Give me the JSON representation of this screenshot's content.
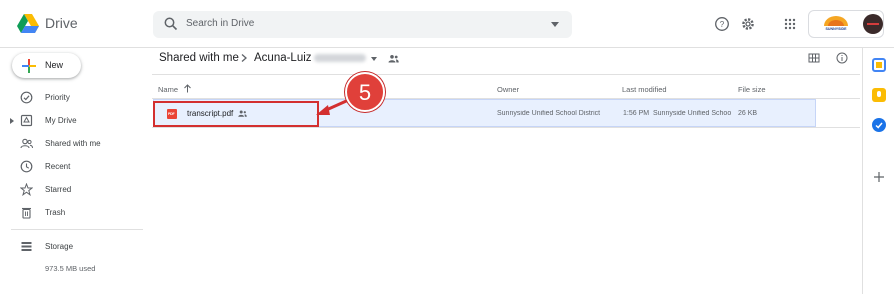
{
  "app": {
    "name": "Drive"
  },
  "search": {
    "placeholder": "Search in Drive"
  },
  "header": {
    "icons": [
      "help-icon",
      "settings-icon",
      "apps-grid-icon"
    ],
    "account": {
      "org_logo": "SUNNYSIDE",
      "avatar": "avatar"
    }
  },
  "sidebar": {
    "new_label": "New",
    "items": [
      {
        "label": "Priority",
        "icon": "priority-icon"
      },
      {
        "label": "My Drive",
        "icon": "my-drive-icon"
      },
      {
        "label": "Shared with me",
        "icon": "shared-with-me-icon"
      },
      {
        "label": "Recent",
        "icon": "clock-icon"
      },
      {
        "label": "Starred",
        "icon": "star-icon"
      },
      {
        "label": "Trash",
        "icon": "trash-icon"
      },
      {
        "label": "Storage",
        "icon": "storage-icon"
      }
    ],
    "storage_used": "973.5 MB used"
  },
  "breadcrumb": {
    "root": "Shared with me",
    "folder": "Acuna-Luiz"
  },
  "table": {
    "headers": {
      "name": "Name",
      "owner": "Owner",
      "last_modified": "Last modified",
      "file_size": "File size"
    },
    "rows": [
      {
        "name": "transcript.pdf",
        "type_badge": "PDF",
        "owner": "Sunnyside Unified School District",
        "modified_time": "1:56 PM",
        "modified_by": "Sunnyside Unified Schoo",
        "size": "26 KB"
      }
    ]
  },
  "annotation": {
    "step_number": "5",
    "color": "#d32f2f"
  },
  "right_rail": {
    "icons": [
      "calendar-icon",
      "keep-icon",
      "tasks-icon",
      "add-icon"
    ]
  }
}
